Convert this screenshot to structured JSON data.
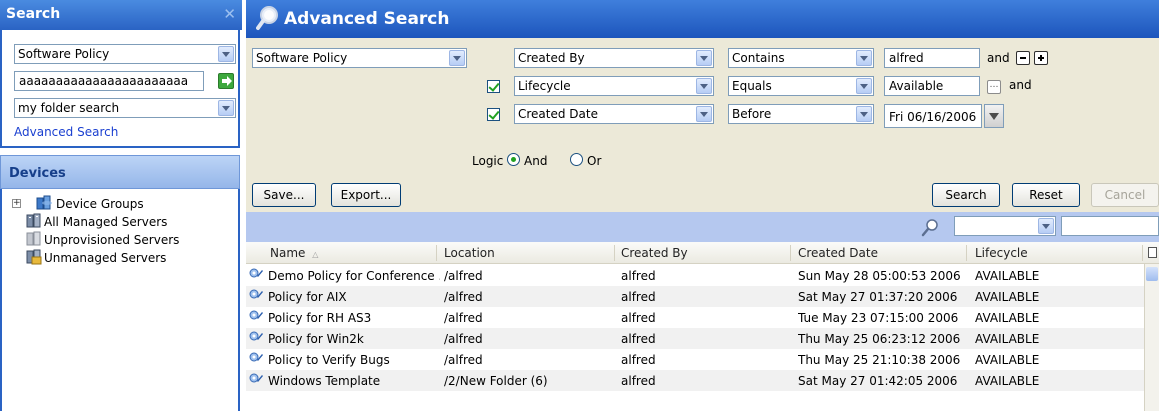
{
  "search_panel": {
    "title": "Search",
    "close_glyph": "✕",
    "type_select": "Software Policy",
    "query_value": "aaaaaaaaaaaaaaaaaaaaaaa",
    "folder_select": "my folder search",
    "advanced_link": "Advanced Search"
  },
  "devices_panel": {
    "title": "Devices",
    "tree": [
      {
        "label": "Device Groups",
        "expandable": true,
        "expand_glyph": "+"
      },
      {
        "label": "All Managed Servers",
        "expandable": false
      },
      {
        "label": "Unprovisioned Servers",
        "expandable": false
      },
      {
        "label": "Unmanaged Servers",
        "expandable": false
      }
    ]
  },
  "advanced": {
    "title": "Advanced Search",
    "type_select": "Software Policy",
    "criteria": [
      {
        "field": "Created By",
        "operator": "Contains",
        "value": "alfred",
        "suffix": "and"
      },
      {
        "field": "Lifecycle",
        "operator": "Equals",
        "value": "Available",
        "suffix": "and"
      },
      {
        "field": "Created Date",
        "operator": "Before",
        "value": "Fri 06/16/2006"
      }
    ],
    "logic_label": "Logic",
    "logic_and": "And",
    "logic_or": "Or",
    "remove_glyph": "−",
    "add_glyph": "+",
    "picker_glyph": "…"
  },
  "toolbar": {
    "save": "Save...",
    "export": "Export...",
    "search": "Search",
    "reset": "Reset",
    "cancel": "Cancel"
  },
  "table": {
    "columns": [
      "Name",
      "Location",
      "Created By",
      "Created Date",
      "Lifecycle"
    ],
    "sort_glyph": "△",
    "rows": [
      [
        "Demo Policy for Conference ...",
        "/alfred",
        "alfred",
        "Sun May 28 05:00:53 2006",
        "AVAILABLE"
      ],
      [
        "Policy for AIX",
        "/alfred",
        "alfred",
        "Sat May 27 01:37:20 2006",
        "AVAILABLE"
      ],
      [
        "Policy for RH AS3",
        "/alfred",
        "alfred",
        "Tue May 23 07:15:00 2006",
        "AVAILABLE"
      ],
      [
        "Policy for Win2k",
        "/alfred",
        "alfred",
        "Thu May 25 06:23:12 2006",
        "AVAILABLE"
      ],
      [
        "Policy to Verify Bugs",
        "/alfred",
        "alfred",
        "Thu May 25 21:10:38 2006",
        "AVAILABLE"
      ],
      [
        "Windows Template",
        "/2/New Folder (6)",
        "alfred",
        "Sat May 27 01:42:05 2006",
        "AVAILABLE"
      ]
    ]
  },
  "colors": {
    "header_blue": "#2a63c4",
    "filter_bar": "#b5c8ef",
    "panel_bg": "#ece9d8"
  }
}
